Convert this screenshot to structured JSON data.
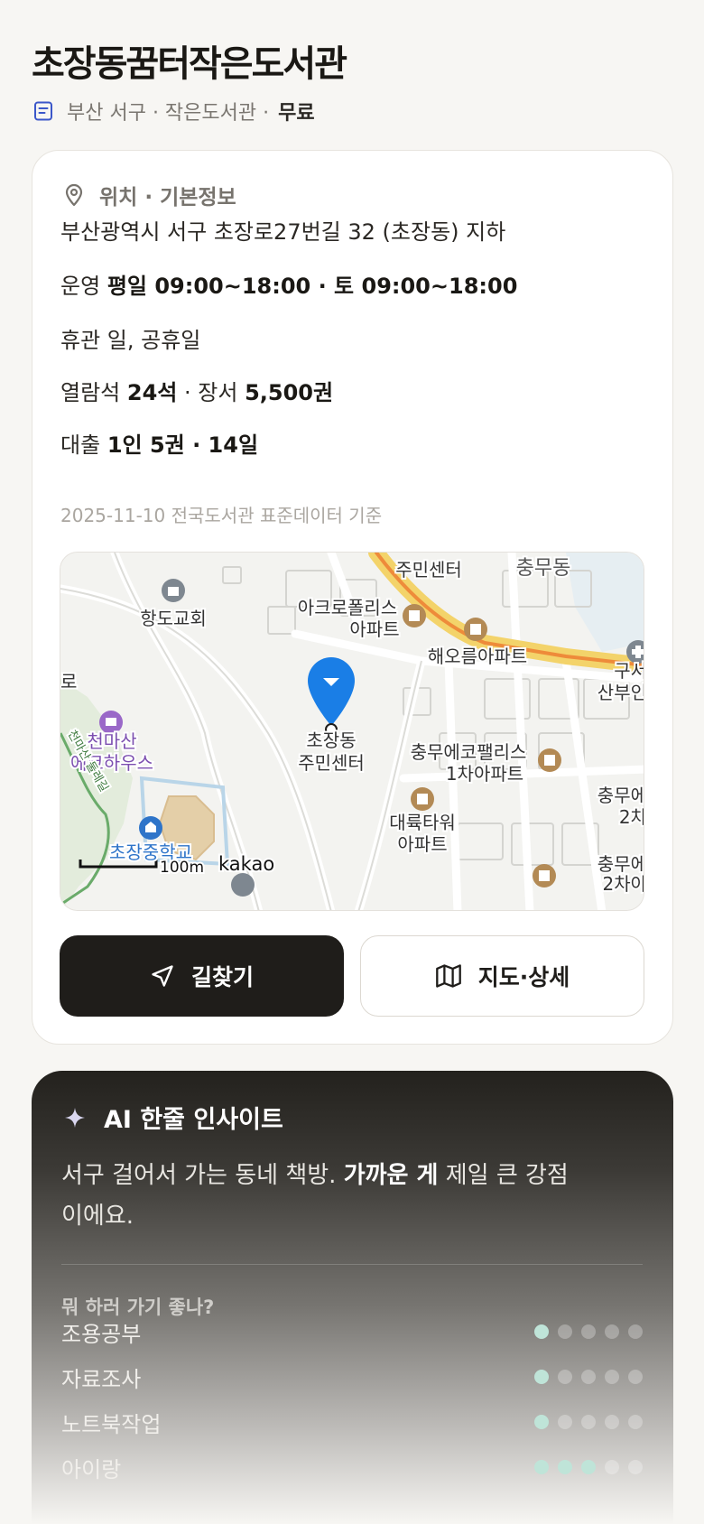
{
  "header": {
    "title": "초장동꿈터작은도서관",
    "subtitle": "부산 서구 · 작은도서관 ·",
    "price": "무료"
  },
  "info": {
    "section_title": "위치 · 기본정보",
    "address": "부산광역시 서구 초장로27번길 32 (초장동) 지하",
    "hours_label": "운영",
    "hours_value": "평일 09:00~18:00 · 토 09:00~18:00",
    "closed": "휴관 일, 공휴일",
    "seats_label": "열람석",
    "seats_value": "24석",
    "books_sep": "· 장서",
    "books_value": "5,500권",
    "loan_label": "대출",
    "loan_value": "1인 5권 · 14일",
    "source_note": "2025-11-10 전국도서관 표준데이터 기준"
  },
  "map": {
    "labels": {
      "church": "항도교회",
      "apt_acropolis_1": "아크로폴리스",
      "apt_acropolis_2": "아파트",
      "center_top": "주민센터",
      "chungmu": "충무동",
      "haeoreum": "해오름아파트",
      "left_edge": "로",
      "gusan_1": "구서",
      "gusan_2": "산부인",
      "cheonmasan_1": "천마산",
      "cheonmasan_2": "에코하우스",
      "pin_1": "초장동",
      "pin_2": "주민센터",
      "eco_palace_1": "충무에코팰리스",
      "eco_palace_2": "1차아파트",
      "chungmu_e2_1": "충무에",
      "chungmu_e2_2": "2차",
      "daeryuk_1": "대륙타워",
      "daeryuk_2": "아파트",
      "school": "초장중학교",
      "scale": "100m",
      "brand": "kakao",
      "chungmu_br_1": "충무에",
      "chungmu_br_2": "2차아",
      "trail": "천마산 둘레길"
    },
    "accent": "#1a7ee6"
  },
  "actions": {
    "directions": "길찾기",
    "map_detail": "지도·상세"
  },
  "ai": {
    "title": "AI 한줄 인사이트",
    "text_a": "서구 걸어서 가는 동네 책방.",
    "text_b": "가까운 게",
    "text_c": "제일 큰 강점이에요.",
    "question": "뭐 하러 가기 좋나?",
    "rows": [
      {
        "label": "조용공부",
        "score": 1
      },
      {
        "label": "자료조사",
        "score": 1
      },
      {
        "label": "노트북작업",
        "score": 1
      },
      {
        "label": "아이랑",
        "score": 3
      }
    ],
    "max_score": 5,
    "dot_on_color": "#bfe4d8"
  }
}
